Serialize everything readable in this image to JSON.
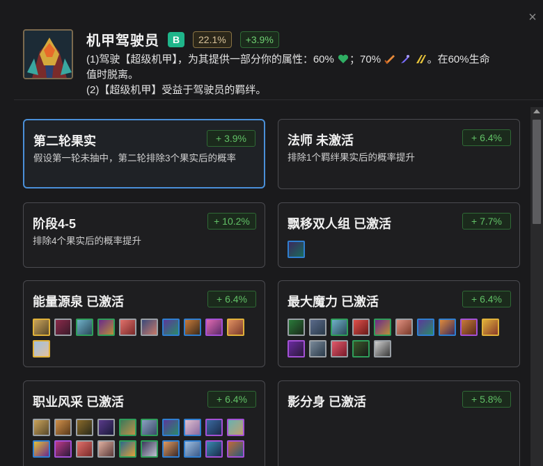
{
  "header": {
    "title": "机甲驾驶员",
    "tier": "B",
    "pick_rate": "22.1%",
    "delta": "+3.9%",
    "desc_line1_a": "(1)驾驶【超级机甲】，为其提供一部分你的属性：60%",
    "desc_line1_b": "；70%",
    "desc_line1_c": "。在60%生命",
    "desc_line2": "值时脱离。",
    "desc_line3": "(2)【超级机甲】受益于驾驶员的羁绊。",
    "icons": [
      "heart-icon",
      "attack-damage-icon",
      "ability-power-icon",
      "attack-speed-icon"
    ]
  },
  "cards": [
    {
      "title": "第二轮果实",
      "boost": "+ 3.9%",
      "desc": "假设第一轮未抽中，第二轮排除3个果实后的概率"
    },
    {
      "title": "法师 未激活",
      "boost": "+ 6.4%",
      "desc": "排除1个羁绊果实后的概率提升"
    },
    {
      "title": "阶段4-5",
      "boost": "+ 10.2%",
      "desc": "排除4个果实后的概率提升"
    },
    {
      "title": "飘移双人组 已激活",
      "boost": "+ 7.7%"
    },
    {
      "title": "能量源泉 已激活",
      "boost": "+ 6.4%"
    },
    {
      "title": "最大魔力 已激活",
      "boost": "+ 6.4%"
    },
    {
      "title": "职业风采 已激活",
      "boost": "+ 6.4%"
    },
    {
      "title": "影分身 已激活",
      "boost": "+ 5.8%"
    }
  ],
  "colors": {
    "accent_blue": "#4a90d9",
    "boost_green": "#62c267",
    "tier_b": "#1fb58a",
    "gold": "#d9c39a"
  }
}
